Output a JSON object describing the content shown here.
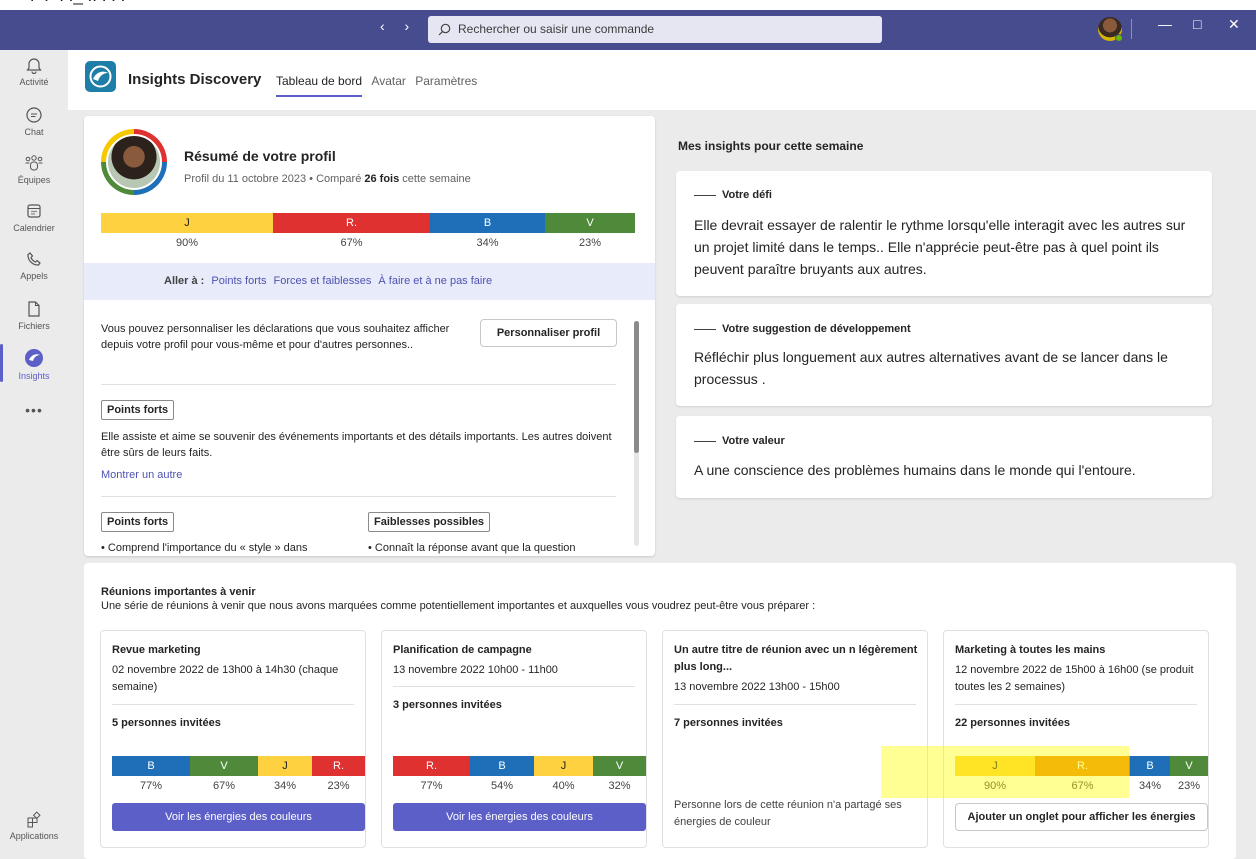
{
  "window": {
    "nav_arrows": "‹ ›",
    "search_placeholder": "Rechercher ou saisir une commande",
    "controls": {
      "min": "—",
      "max": "□",
      "close": "✕"
    }
  },
  "rail": {
    "items": [
      {
        "label": "Activité",
        "icon": "bell-icon"
      },
      {
        "label": "Chat",
        "icon": "chat-icon"
      },
      {
        "label": "Équipes",
        "icon": "teams-icon"
      },
      {
        "label": "Calendrier",
        "icon": "calendar-icon"
      },
      {
        "label": "Appels",
        "icon": "phone-icon"
      },
      {
        "label": "Fichiers",
        "icon": "file-icon"
      },
      {
        "label": "Insights",
        "icon": "insights-icon"
      }
    ],
    "more": "•••",
    "apps_label": "Applications"
  },
  "app": {
    "title": "Insights Discovery",
    "tabs": [
      "Tableau de bord",
      "Avatar",
      "Paramètres"
    ]
  },
  "profile": {
    "title": "Résumé de votre profil",
    "subtitle_pre": "Profil du 11 octobre 2023 • Comparé ",
    "subtitle_bold": "26 fois",
    "subtitle_post": " cette semaine",
    "energies": [
      {
        "label": "J",
        "pct": "90%",
        "color": "#fed141"
      },
      {
        "label": "R.",
        "pct": "67%",
        "color": "#e03131"
      },
      {
        "label": "B",
        "pct": "34%",
        "color": "#1f6fb8"
      },
      {
        "label": "V",
        "pct": "23%",
        "color": "#4e8a3a"
      }
    ],
    "goto_label": "Aller à :",
    "goto_links": [
      "Points forts",
      "Forces et faiblesses",
      "À faire et à ne pas faire"
    ],
    "desc": "Vous pouvez personnaliser les déclarations que vous souhaitez afficher depuis votre profil pour vous-même et pour d'autres personnes..",
    "customize_btn": "Personnaliser profil",
    "strengths_tag": "Points forts",
    "strengths_text": "Elle assiste et aime se souvenir des événements importants et des détails importants. Les autres doivent être sûrs de leurs faits.",
    "show_other": "Montrer un autre",
    "strengths_tag2": "Points forts",
    "weak_tag": "Faiblesses possibles",
    "strengths_item": "• Comprend l'importance du « style » dans",
    "weak_item": "• Connaît la réponse avant que la question"
  },
  "insights": {
    "title": "Mes insights pour cette semaine",
    "cards": [
      {
        "label": "Votre défi",
        "text": "Elle devrait essayer de ralentir le rythme lorsqu'elle interagit avec les autres sur un projet limité dans le temps.. Elle n'apprécie peut-être pas à quel point ils peuvent paraître bruyants aux autres."
      },
      {
        "label": "Votre suggestion de développement",
        "text": "Réfléchir plus longuement aux autres alternatives avant de se lancer dans le processus ."
      },
      {
        "label": "Votre valeur",
        "text": "A une conscience des problèmes humains dans le monde qui l'entoure."
      }
    ]
  },
  "meetings": {
    "title": "Réunions importantes à venir",
    "subtitle": "Une série de réunions à venir que nous avons marquées comme potentiellement importantes et auxquelles vous voudrez peut-être vous préparer :",
    "cards": [
      {
        "title": "Revue marketing",
        "date": "02 novembre 2022 de 13h00 à 14h30 (chaque semaine)",
        "invited": "5 personnes invitées",
        "energies": [
          {
            "label": "B",
            "pct": "77%",
            "color": "#1f6fb8"
          },
          {
            "label": "V",
            "pct": "67%",
            "color": "#4e8a3a"
          },
          {
            "label": "J",
            "pct": "34%",
            "color": "#fed141"
          },
          {
            "label": "R.",
            "pct": "23%",
            "color": "#e03131"
          }
        ],
        "button": "Voir les énergies des couleurs"
      },
      {
        "title": "Planification de campagne",
        "date": "13 novembre 2022 10h00 - 11h00",
        "invited": "3 personnes invitées",
        "energies": [
          {
            "label": "R.",
            "pct": "77%",
            "color": "#e03131"
          },
          {
            "label": "B",
            "pct": "54%",
            "color": "#1f6fb8"
          },
          {
            "label": "J",
            "pct": "40%",
            "color": "#fed141"
          },
          {
            "label": "V",
            "pct": "32%",
            "color": "#4e8a3a"
          }
        ],
        "button": "Voir les énergies des couleurs"
      },
      {
        "title": "Un autre titre de réunion avec un n légèrement plus long...",
        "date": "13 novembre 2022 13h00 - 15h00",
        "invited": "7 personnes invitées",
        "note": "Personne lors de cette réunion n'a partagé ses énergies de couleur"
      },
      {
        "title": "Marketing à toutes les mains",
        "date": "12 novembre 2022 de 15h00 à 16h00 (se produit toutes les 2 semaines)",
        "invited": "22 personnes invitées",
        "energies": [
          {
            "label": "J",
            "pct": "90%",
            "color": "#fed141"
          },
          {
            "label": "R.",
            "pct": "67%",
            "color": "#ec8a10"
          },
          {
            "label": "B",
            "pct": "34%",
            "color": "#1f6fb8"
          },
          {
            "label": "V",
            "pct": "23%",
            "color": "#4e8a3a"
          }
        ],
        "button": "Ajouter un onglet pour afficher les énergies"
      }
    ]
  }
}
